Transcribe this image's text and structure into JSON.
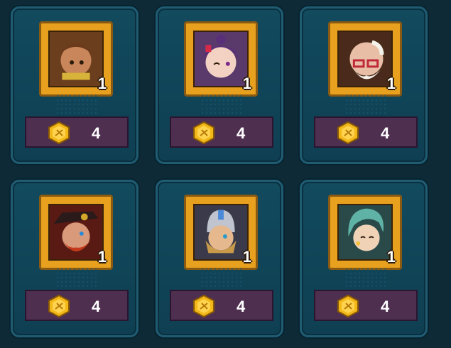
{
  "colors": {
    "background": "#0e2a36",
    "card_border": "#1f5c72",
    "frame": "#e7a11e",
    "price_bar": "#4e2f4f",
    "coin": "#f2b81a"
  },
  "currency_icon": "gold-hex-coin-icon",
  "cards": [
    {
      "hero": "hero-portrait-1",
      "quantity": "1",
      "price": "4"
    },
    {
      "hero": "hero-portrait-2",
      "quantity": "1",
      "price": "4"
    },
    {
      "hero": "hero-portrait-3",
      "quantity": "1",
      "price": "4"
    },
    {
      "hero": "hero-portrait-4",
      "quantity": "1",
      "price": "4"
    },
    {
      "hero": "hero-portrait-5",
      "quantity": "1",
      "price": "4"
    },
    {
      "hero": "hero-portrait-6",
      "quantity": "1",
      "price": "4"
    }
  ]
}
